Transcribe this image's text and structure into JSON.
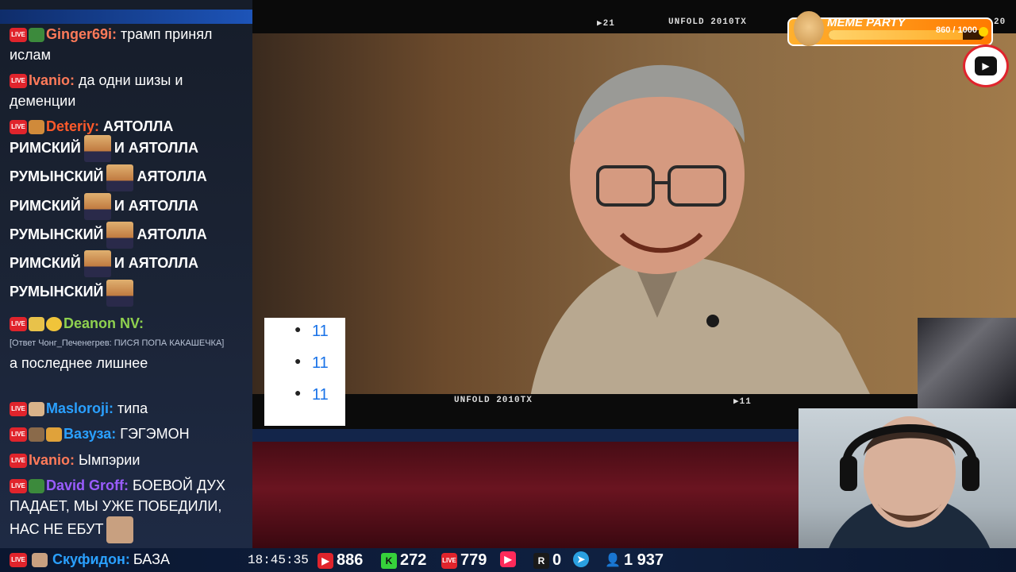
{
  "scene": {
    "top_tag_left": "▶21",
    "top_tag_title": "UNFOLD 2010TX",
    "top_tag_right": "20",
    "bottom_tag_title": "UNFOLD 2010TX",
    "bottom_tag_right": "▶11"
  },
  "meme_party": {
    "title": "MEME PARTY",
    "count": "860 / 1000",
    "progress": 0.86
  },
  "overlay_list": [
    "11",
    "11",
    "11"
  ],
  "chat": [
    {
      "user": "Ginger69i:",
      "user_color": "#ff7a59",
      "text": "трамп принял ислам"
    },
    {
      "user": "Ivanio:",
      "user_color": "#ff7a59",
      "text": "да одни шизы и деменции"
    },
    {
      "user": "Deteriy:",
      "user_color": "#ff5a2a",
      "text": "АЯТОЛЛА"
    },
    {
      "caps_lines": [
        {
          "a": "РИМСКИЙ",
          "b": "И АЯТОЛЛА"
        },
        {
          "a": "РУМЫНСКИЙ",
          "b": "АЯТОЛЛА"
        },
        {
          "a": "РИМСКИЙ",
          "b": "И АЯТОЛЛА"
        },
        {
          "a": "РУМЫНСКИЙ",
          "b": "АЯТОЛЛА"
        },
        {
          "a": "РИМСКИЙ",
          "b": "И АЯТОЛЛА"
        },
        {
          "a": "РУМЫНСКИЙ",
          "b": ""
        }
      ]
    },
    {
      "user": "Deanon NV:",
      "user_color": "#8fd14f",
      "reply": "[Ответ Чонг_Печенегрев: ПИСЯ ПОПА КАКАШЕЧКА]",
      "text": "а последнее лишнее"
    },
    {
      "user": "Masloroji:",
      "user_color": "#2aa0ff",
      "text": "типа"
    },
    {
      "user": "Вазуза:",
      "user_color": "#2aa0ff",
      "text": "ГЭГЭМОН"
    },
    {
      "user": "Ivanio:",
      "user_color": "#ff7a59",
      "text": "Ымпэрии"
    },
    {
      "user": "David Groff:",
      "user_color": "#9a5cff",
      "text": "БОЕВОЙ ДУХ ПАДАЕТ, МЫ УЖЕ ПОБЕДИЛИ, НАС НЕ ЕБУТ"
    },
    {
      "user": "Скуфидон:",
      "user_color": "#2aa0ff",
      "text": "БАЗА"
    }
  ],
  "live_badge": "LIVE",
  "statusbar": {
    "time": "18:45:35",
    "youtube": "886",
    "kick": "272",
    "vk": "779",
    "rutube": "0",
    "viewers": "1 937"
  }
}
